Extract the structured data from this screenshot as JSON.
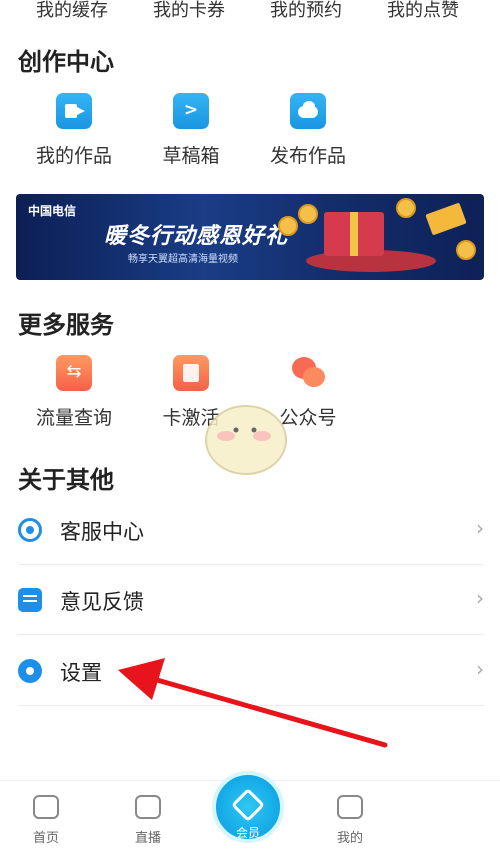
{
  "top_row": [
    "我的缓存",
    "我的卡券",
    "我的预约",
    "我的点赞"
  ],
  "creation_center": {
    "title": "创作中心",
    "items": [
      {
        "label": "我的作品",
        "icon": "video-camera-icon"
      },
      {
        "label": "草稿箱",
        "icon": "drafts-icon"
      },
      {
        "label": "发布作品",
        "icon": "cloud-upload-icon"
      }
    ]
  },
  "banner": {
    "logo_text": "中国电信",
    "headline": "暖冬行动感恩好礼",
    "subtext": "畅享天翼超高清海量视频"
  },
  "more_services": {
    "title": "更多服务",
    "items": [
      {
        "label": "流量查询",
        "icon": "traffic-exchange-icon"
      },
      {
        "label": "卡激活",
        "icon": "sim-card-icon"
      },
      {
        "label": "公众号",
        "icon": "chat-bubbles-icon"
      }
    ]
  },
  "about_others": {
    "title": "关于其他",
    "rows": [
      {
        "label": "客服中心",
        "icon": "customer-service-icon"
      },
      {
        "label": "意见反馈",
        "icon": "feedback-icon"
      },
      {
        "label": "设置",
        "icon": "gear-icon"
      }
    ]
  },
  "bottom_nav": {
    "tabs": [
      {
        "label": "首页",
        "icon": "home-video-icon"
      },
      {
        "label": "直播",
        "icon": "tv-icon"
      },
      {
        "label": "会员",
        "icon": "diamond-icon"
      },
      {
        "label": "我的",
        "icon": "profile-icon"
      }
    ]
  },
  "colors": {
    "accent": "#1e8fe8",
    "annotation_arrow": "#e8141b"
  }
}
